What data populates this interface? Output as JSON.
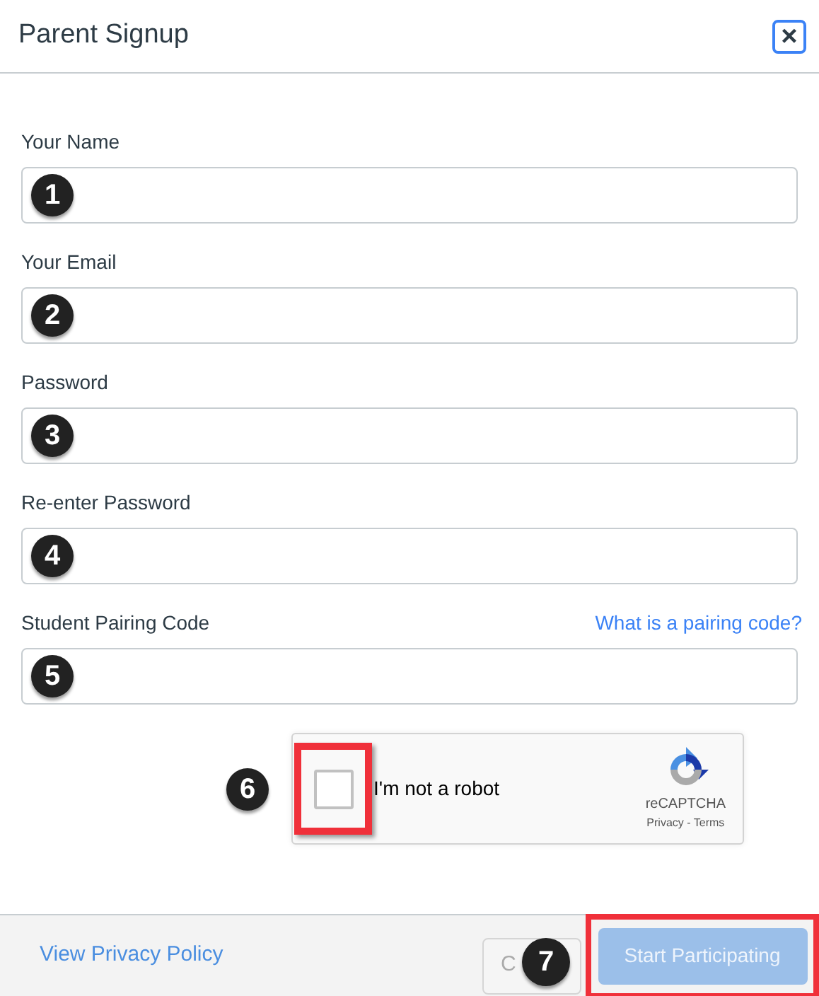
{
  "window": {
    "title": "Parent Signup",
    "close": "×"
  },
  "fields": [
    {
      "label": "Your Name",
      "marker": "1"
    },
    {
      "label": "Your Email",
      "marker": "2"
    },
    {
      "label": "Password",
      "marker": "3"
    },
    {
      "label": "Re-enter Password",
      "marker": "4"
    },
    {
      "label": "Student Pairing Code",
      "marker": "5",
      "link": "What is a pairing code?"
    }
  ],
  "captcha": {
    "marker": "6",
    "checked": false,
    "label": "I'm not a robot",
    "brand": "reCAPTCHA",
    "links": "Privacy - Terms",
    "highlighted": true
  },
  "footer": {
    "link": "View Privacy Policy",
    "cancel": "C",
    "marker": "7",
    "submit": {
      "label": "Start Participating",
      "disabled": true,
      "highlighted": true
    }
  }
}
